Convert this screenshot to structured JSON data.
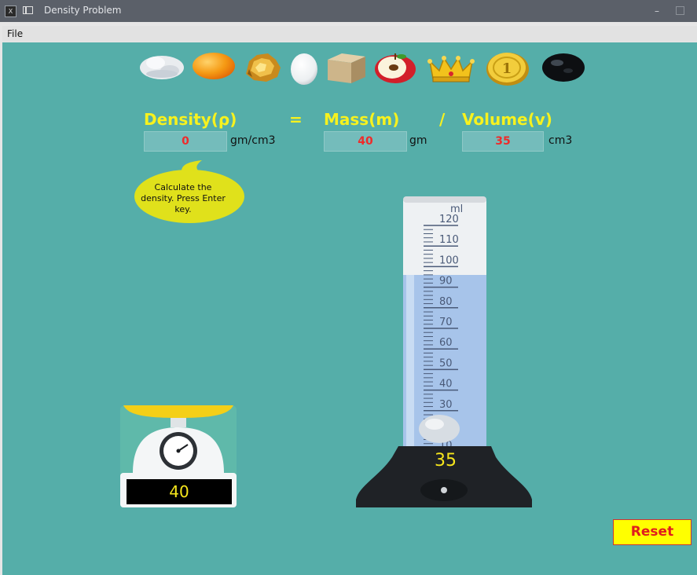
{
  "window": {
    "title": "Density Problem",
    "app_icon": "x-app-icon",
    "minimize_glyph": "–"
  },
  "menu": {
    "file_label": "File"
  },
  "objects": [
    {
      "name": "cotton",
      "icon": "cotton-ball-icon"
    },
    {
      "name": "orange-ball",
      "icon": "orange-ball-icon"
    },
    {
      "name": "gold-nugget",
      "icon": "gold-nugget-icon"
    },
    {
      "name": "egg",
      "icon": "egg-icon"
    },
    {
      "name": "wood-block",
      "icon": "wood-block-icon"
    },
    {
      "name": "apple",
      "icon": "apple-icon"
    },
    {
      "name": "crown",
      "icon": "crown-icon"
    },
    {
      "name": "coin",
      "icon": "coin-icon"
    },
    {
      "name": "black-stone",
      "icon": "black-stone-icon"
    }
  ],
  "coin_text": "1",
  "equation": {
    "density_label": "Density(ρ)",
    "equals": "=",
    "mass_label": "Mass(m)",
    "divide": "/",
    "volume_label": "Volume(v)",
    "density_value": "0",
    "density_unit": "gm/cm3",
    "mass_value": "40",
    "mass_unit": "gm",
    "volume_value": "35",
    "volume_unit": "cm3"
  },
  "hint": {
    "text": "Calculate the density. Press Enter key."
  },
  "scale": {
    "reading": "40"
  },
  "cylinder": {
    "unit_label": "ml",
    "tick_labels": [
      "120",
      "110",
      "100",
      "90",
      "80",
      "70",
      "60",
      "50",
      "40",
      "30",
      "20",
      "10"
    ],
    "fill_level_ml": 90,
    "reading": "35"
  },
  "reset_label": "Reset",
  "colors": {
    "background": "#55aea9",
    "equation_text": "#f7f21e",
    "field_value": "#ee2b2b",
    "reset_bg": "#ffff00",
    "reset_text": "#e01d1d",
    "display_digits": "#f6e61c"
  }
}
